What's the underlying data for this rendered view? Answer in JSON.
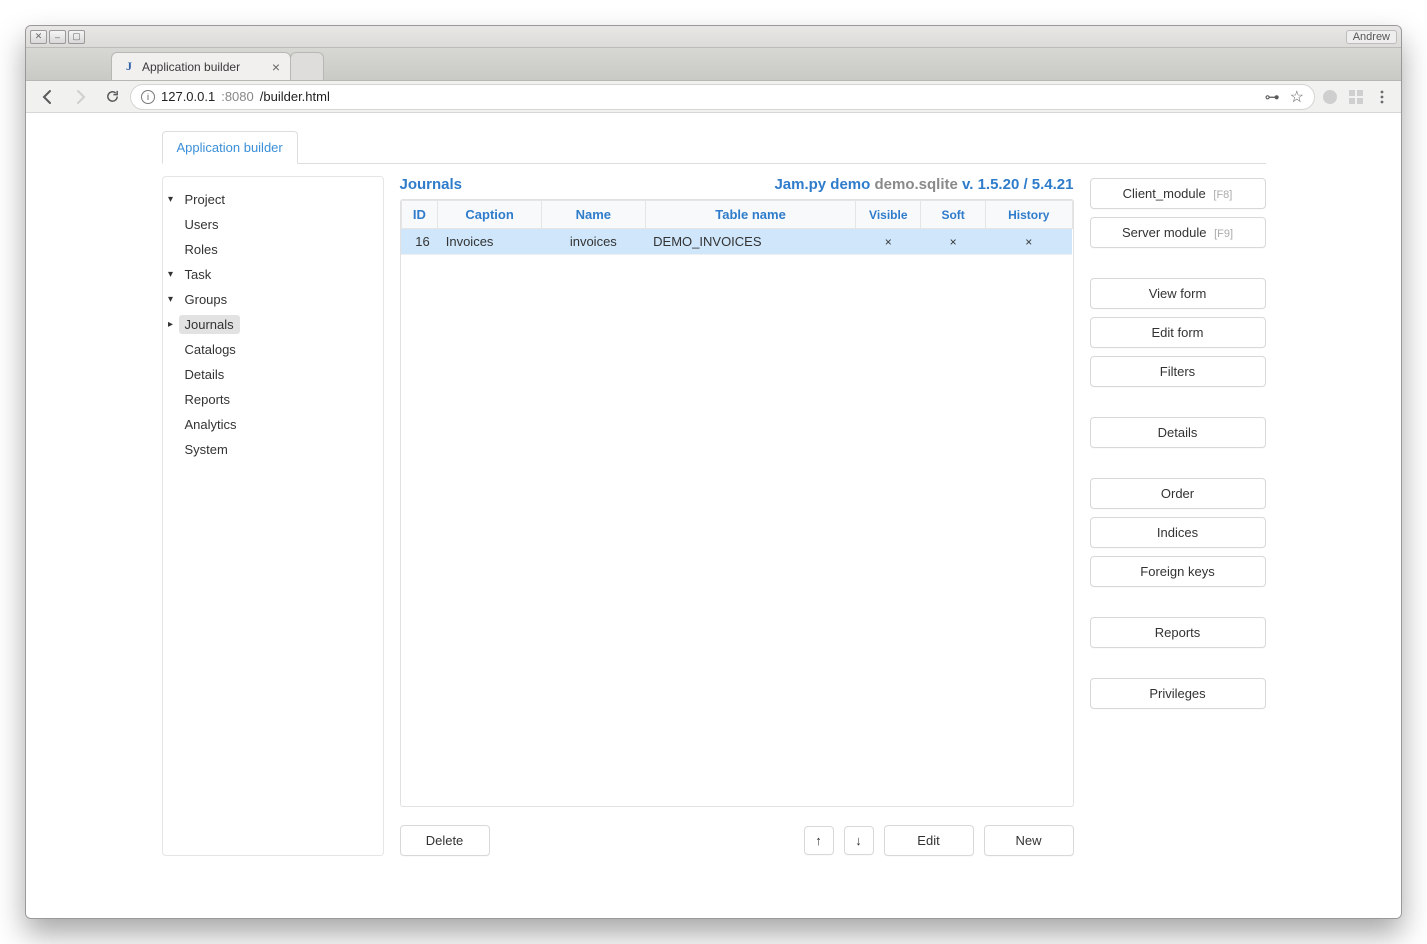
{
  "os": {
    "close_glyph": "✕",
    "min_glyph": "–",
    "max_glyph": "▢",
    "user": "Andrew"
  },
  "browser": {
    "tab_title": "Application builder",
    "favicon_letter": "J",
    "url_host": "127.0.0.1",
    "url_port": ":8080",
    "url_path": "/builder.html",
    "key_glyph": "⊶",
    "star_glyph": "☆"
  },
  "app_tab": {
    "label": "Application builder"
  },
  "tree": {
    "project": "Project",
    "users": "Users",
    "roles": "Roles",
    "task": "Task",
    "groups": "Groups",
    "journals": "Journals",
    "catalogs": "Catalogs",
    "details": "Details",
    "reports": "Reports",
    "analytics": "Analytics",
    "system": "System"
  },
  "header": {
    "title": "Journals",
    "app_name": "Jam.py demo",
    "db_name": "demo.sqlite",
    "version": "v. 1.5.20 / 5.4.21"
  },
  "grid": {
    "cols": {
      "id": "ID",
      "caption": "Caption",
      "name": "Name",
      "table": "Table name",
      "visible": "Visible",
      "soft": "Soft",
      "history": "History"
    },
    "rows": [
      {
        "id": "16",
        "caption": "Invoices",
        "name": "invoices",
        "table": "DEMO_INVOICES",
        "visible": "×",
        "soft": "×",
        "history": "×"
      }
    ]
  },
  "buttons": {
    "delete": "Delete",
    "up": "↑",
    "down": "↓",
    "edit": "Edit",
    "new": "New",
    "client_module": "Client_module",
    "client_module_hint": "[F8]",
    "server_module": "Server module",
    "server_module_hint": "[F9]",
    "view_form": "View form",
    "edit_form": "Edit form",
    "filters": "Filters",
    "details": "Details",
    "order": "Order",
    "indices": "Indices",
    "foreign_keys": "Foreign keys",
    "reports": "Reports",
    "privileges": "Privileges"
  }
}
